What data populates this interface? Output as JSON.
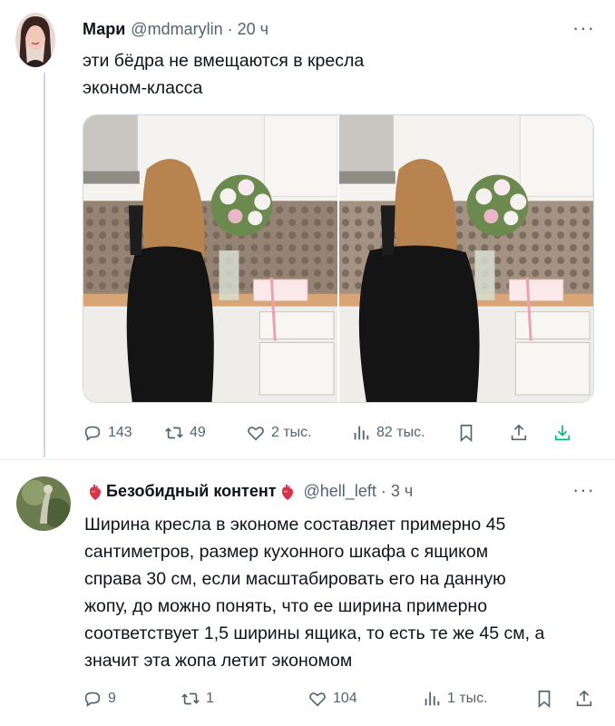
{
  "tweet1": {
    "name": "Мари",
    "handle": "@mdmarylin",
    "time": "20 ч",
    "text_line1": "эти бёдра не вмещаются в кресла",
    "text_line2": "эконом-класса",
    "replies": "143",
    "retweets": "49",
    "likes": "2 тыс.",
    "views": "82 тыс."
  },
  "tweet2": {
    "name": "Безобидный контент",
    "handle": "@hell_left",
    "time": "3 ч",
    "text_lines": [
      "Ширина кресла в экономе составляет примерно 45",
      "сантиметров, размер кухонного шкафа с ящиком",
      "справа 30 см, если масштабировать его на данную",
      "жопу, до можно понять, что ее ширина примерно",
      "соответствует 1,5 ширины ящика, то есть те же 45 см, а",
      "значит эта жопа летит экономом"
    ],
    "replies": "9",
    "retweets": "1",
    "likes": "104",
    "views": "1 тыс."
  },
  "more_label": "···",
  "icons": [
    "reply-icon",
    "retweet-icon",
    "like-icon",
    "views-icon",
    "bookmark-icon",
    "share-icon",
    "download-icon"
  ],
  "colors": {
    "text": "#0f1419",
    "secondary": "#536471",
    "download_accent": "#00ba7c",
    "divider": "#cfd9de"
  }
}
